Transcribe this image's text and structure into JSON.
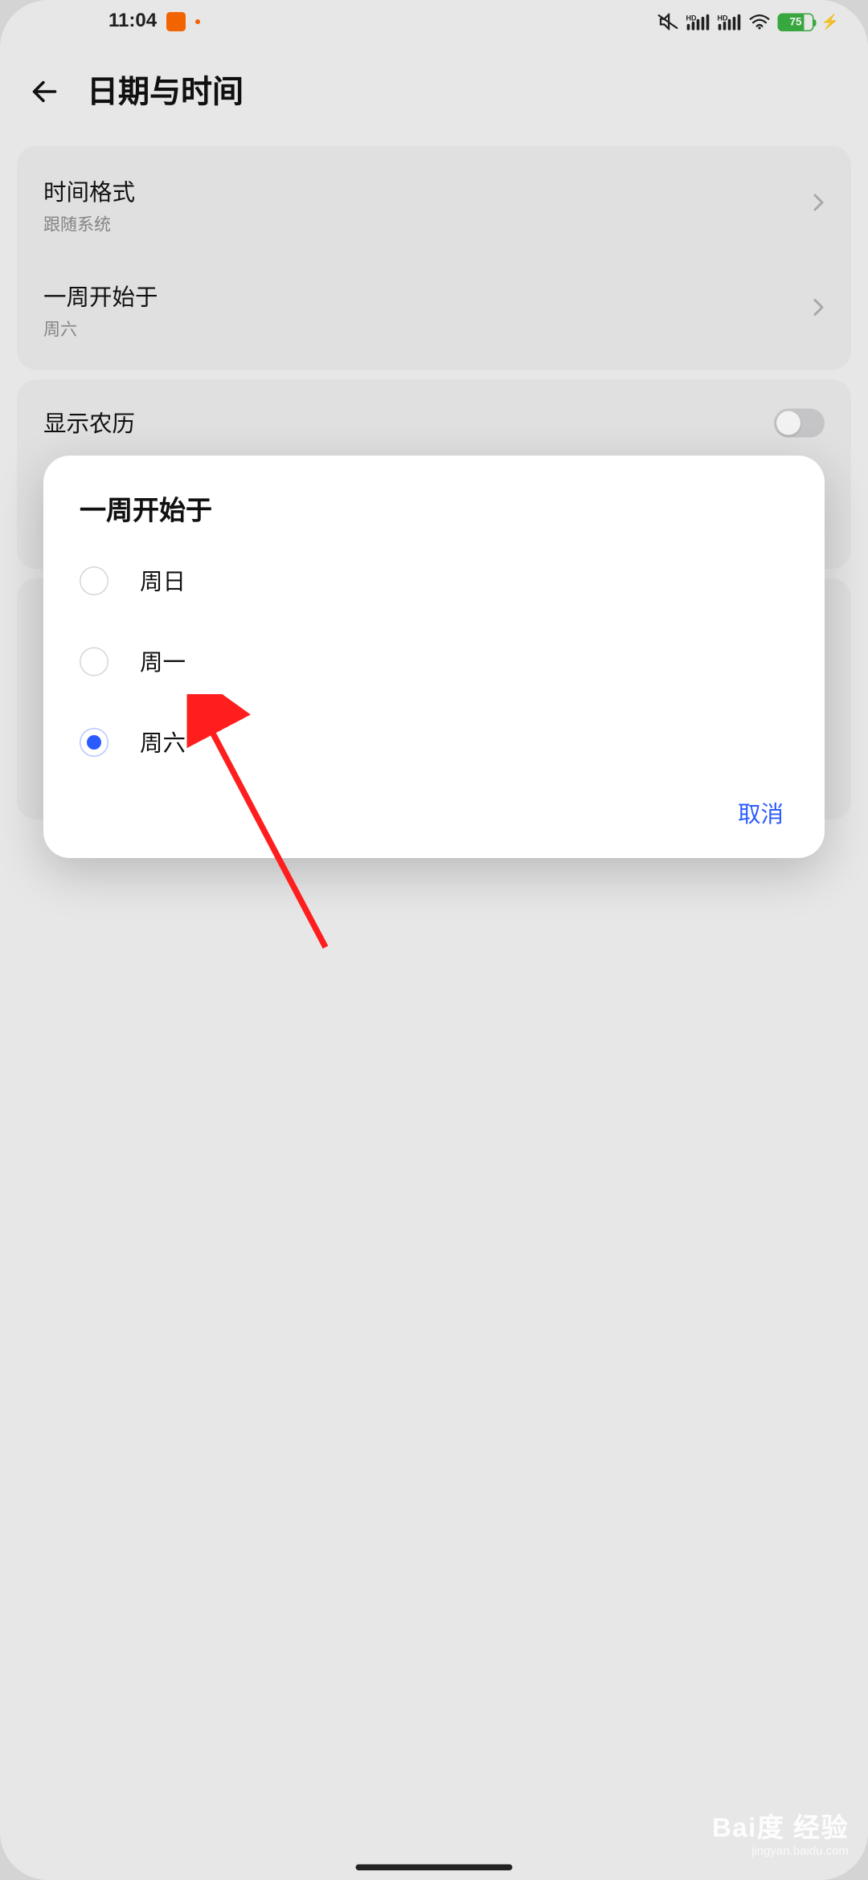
{
  "statusbar": {
    "time": "11:04",
    "battery_pct": "75"
  },
  "appbar": {
    "title": "日期与时间"
  },
  "card1": {
    "row1_title": "时间格式",
    "row1_sub": "跟随系统",
    "row2_title": "一周开始于",
    "row2_sub": "周六"
  },
  "card2": {
    "row1_title": "显示农历"
  },
  "dialog": {
    "title": "一周开始于",
    "options": {
      "o0": "周日",
      "o1": "周一",
      "o2": "周六"
    },
    "selected_index": 2,
    "cancel": "取消"
  },
  "watermark": {
    "main": "Bai度 经验",
    "sub": "jingyan.baidu.com"
  }
}
